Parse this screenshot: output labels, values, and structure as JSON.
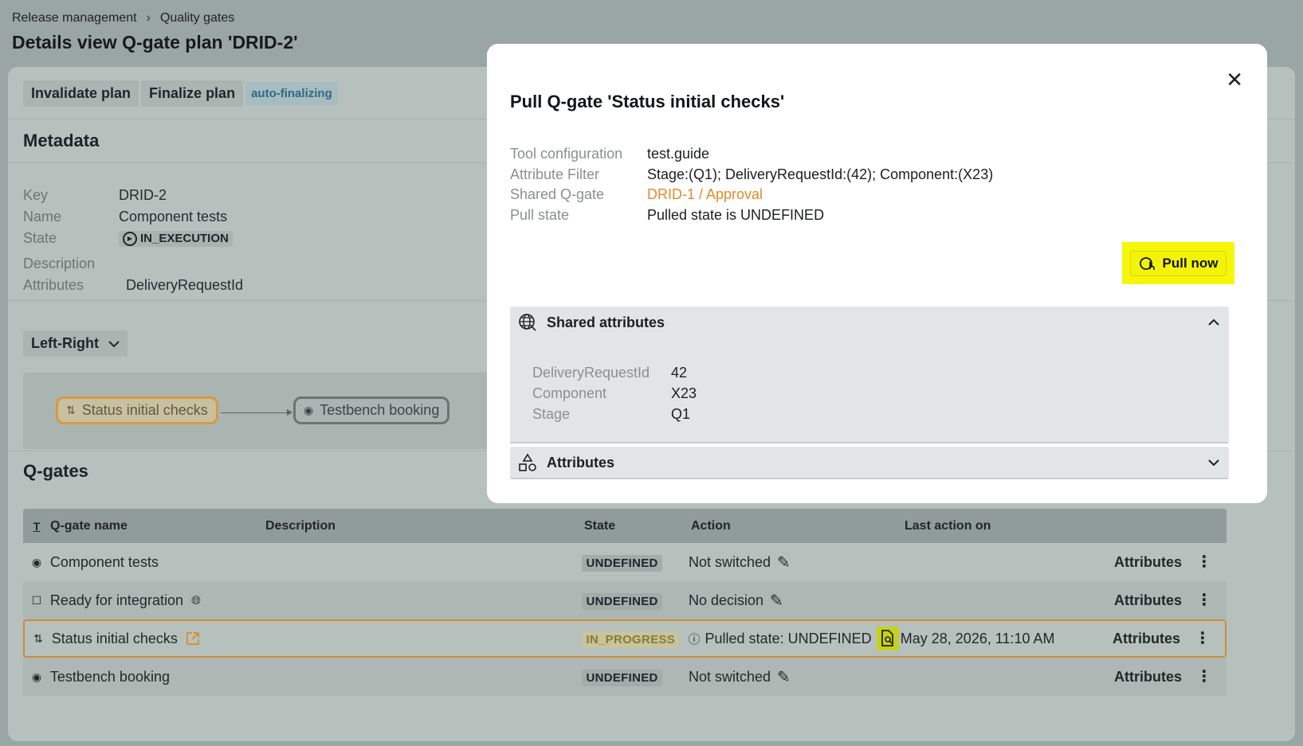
{
  "breadcrumb": {
    "items": [
      "Release management",
      "Quality gates"
    ],
    "separator": "›"
  },
  "page_title": "Details view Q-gate plan 'DRID-2'",
  "toolbar": {
    "invalidate_label": "Invalidate plan",
    "finalize_label": "Finalize plan",
    "auto_label": "auto-finalizing"
  },
  "metadata": {
    "title": "Metadata",
    "key_label": "Key",
    "key_value": "DRID-2",
    "name_label": "Name",
    "name_value": "Component tests",
    "state_label": "State",
    "state_value": "IN_EXECUTION",
    "description_label": "Description",
    "attributes_label": "Attributes",
    "attributes_value": "DeliveryRequestId"
  },
  "layout_select": {
    "value": "Left-Right"
  },
  "flow": {
    "node1": "Status initial checks",
    "node2": "Testbench booking"
  },
  "qgates": {
    "title": "Q-gates",
    "columns": {
      "type": "T",
      "name": "Q-gate name",
      "description": "Description",
      "state": "State",
      "action": "Action",
      "last": "Last action on"
    },
    "rows": [
      {
        "name": "Component tests",
        "state": "UNDEFINED",
        "action": "Not switched",
        "last": "",
        "attributes": "Attributes"
      },
      {
        "name": "Ready for integration",
        "state": "UNDEFINED",
        "action": "No decision",
        "last": "",
        "attributes": "Attributes"
      },
      {
        "name": "Status initial checks",
        "state": "IN_PROGRESS",
        "action": "Pulled state: UNDEFINED",
        "last": "May 28, 2026, 11:10 AM",
        "attributes": "Attributes"
      },
      {
        "name": "Testbench booking",
        "state": "UNDEFINED",
        "action": "Not switched",
        "last": "",
        "attributes": "Attributes"
      }
    ]
  },
  "modal": {
    "title": "Pull Q-gate 'Status initial checks'",
    "tool_config_label": "Tool configuration",
    "tool_config_value": "test.guide",
    "attr_filter_label": "Attribute Filter",
    "attr_filter_value": "Stage:(Q1); DeliveryRequestId:(42); Component:(X23)",
    "shared_qgate_label": "Shared Q-gate",
    "shared_qgate_value": "DRID-1 / Approval",
    "pull_state_label": "Pull state",
    "pull_state_value": "Pulled state is UNDEFINED",
    "pull_button": "Pull now",
    "shared_attributes": {
      "title": "Shared attributes",
      "items": [
        {
          "key": "DeliveryRequestId",
          "value": "42"
        },
        {
          "key": "Component",
          "value": "X23"
        },
        {
          "key": "Stage",
          "value": "Q1"
        }
      ]
    },
    "attributes_panel": {
      "title": "Attributes"
    }
  }
}
